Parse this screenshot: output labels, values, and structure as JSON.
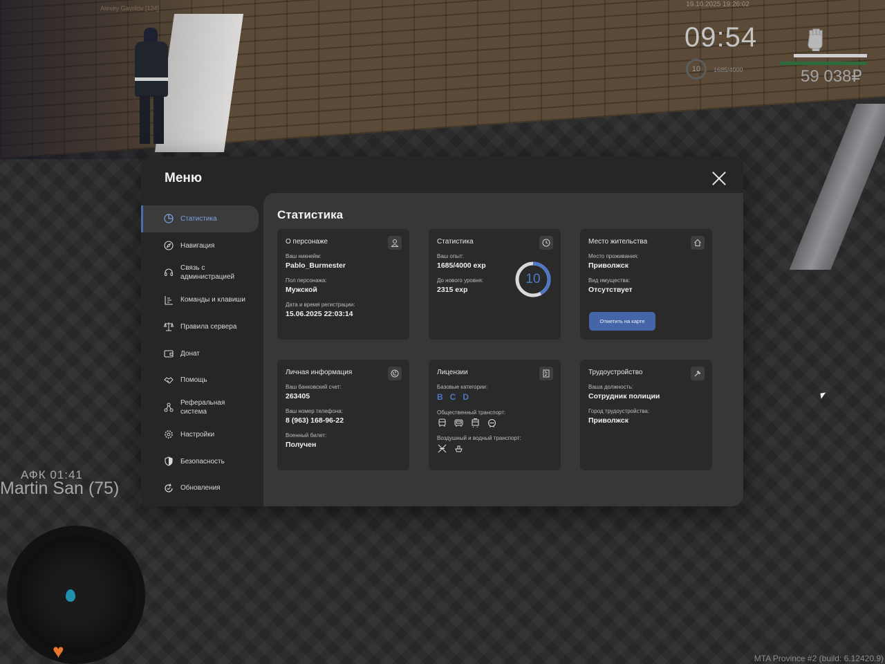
{
  "hud": {
    "top_player": "Alexey Gavrilov [124]",
    "datetime": "19.10.2025 19:26:02",
    "clock": "09:54",
    "level": "10",
    "exp": "1685/4000",
    "money": "59 038₽",
    "health_fraction": 0.84,
    "armor_fraction": 1.0,
    "afk": "АФК 01:41",
    "player_name": "Martin San (75)",
    "build": "MTA Province #2 (build: 6.12420.9)"
  },
  "menu": {
    "title": "Меню",
    "close_icon": "close-icon",
    "items": [
      {
        "label": "Статистика",
        "icon": "chart-icon",
        "active": true
      },
      {
        "label": "Навигация",
        "icon": "compass-icon"
      },
      {
        "label": "Связь с администрацией",
        "icon": "headset-icon"
      },
      {
        "label": "Команды и клавиши",
        "icon": "keyboard-icon"
      },
      {
        "label": "Правила сервера",
        "icon": "scales-icon"
      },
      {
        "label": "Донат",
        "icon": "wallet-icon"
      },
      {
        "label": "Помощь",
        "icon": "handshake-icon"
      },
      {
        "label": "Реферальная система",
        "icon": "network-icon"
      },
      {
        "label": "Настройки",
        "icon": "gear-icon"
      },
      {
        "label": "Безопасность",
        "icon": "shield-icon"
      },
      {
        "label": "Обновления",
        "icon": "refresh-icon"
      }
    ]
  },
  "stats": {
    "title": "Статистика",
    "character": {
      "title": "О персонаже",
      "icon": "user-icon",
      "nickname_label": "Ваш никнейм:",
      "nickname": "Pablo_Burmester",
      "gender_label": "Пол персонажа:",
      "gender": "Мужской",
      "reg_label": "Дата и время регистрации:",
      "reg": "15.06.2025 22:03:14"
    },
    "statistics": {
      "title": "Статистика",
      "icon": "clock-icon",
      "exp_label": "Ваш опыт:",
      "exp": "1685/4000 exp",
      "next_label": "До нового уровня:",
      "next": "2315 exp",
      "level": "10",
      "progress_fraction": 0.42,
      "accent": "#4f78c4"
    },
    "residence": {
      "title": "Место жительства",
      "icon": "home-icon",
      "place_label": "Место проживания:",
      "place": "Приволжск",
      "property_label": "Вид имущества:",
      "property": "Отсутствует",
      "button": "Отметить на карте"
    },
    "personal": {
      "title": "Личная информация",
      "icon": "globe-icon",
      "bank_label": "Ваш банковский счет:",
      "bank": "263405",
      "phone_label": "Ваш номер телефона:",
      "phone": "8 (963) 168-96-22",
      "military_label": "Военный билет:",
      "military": "Получен"
    },
    "licenses": {
      "title": "Лицензии",
      "icon": "license-icon",
      "base_label": "Базовые категории:",
      "categories": [
        "B",
        "C",
        "D"
      ],
      "public_label": "Общественный транспорт:",
      "public_icons": [
        "bus-icon",
        "bus-front-icon",
        "tram-icon",
        "trolleybus-icon"
      ],
      "air_label": "Воздушный и водный транспорт:",
      "air_icons": [
        "plane-icon",
        "boat-icon"
      ]
    },
    "employment": {
      "title": "Трудоустройство",
      "icon": "hammer-icon",
      "position_label": "Ваша должность:",
      "position": "Сотрудник полиции",
      "city_label": "Город трудоустройства:",
      "city": "Приволжск"
    }
  }
}
